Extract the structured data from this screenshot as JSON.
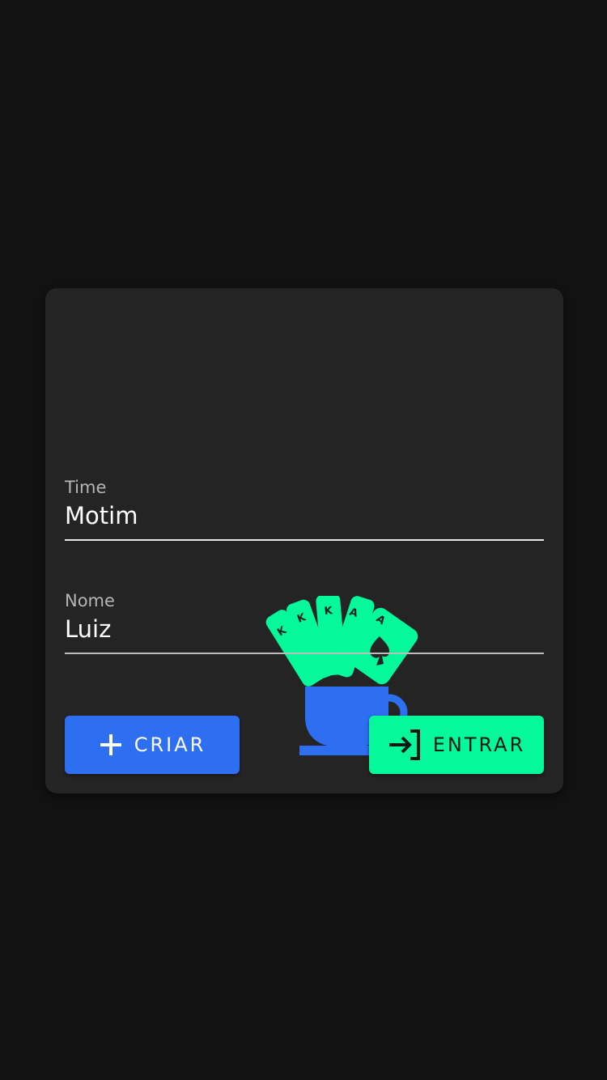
{
  "logo": {
    "name": "cards-and-coffee-cup-logo",
    "card_letters": [
      "K",
      "K",
      "K",
      "A",
      "A"
    ],
    "colors": {
      "cards": "#05f99a",
      "cup": "#2d6ff0"
    }
  },
  "form": {
    "team": {
      "label": "Time",
      "value": "Motim"
    },
    "name": {
      "label": "Nome",
      "value": "Luiz"
    }
  },
  "buttons": {
    "create": {
      "label": "CRIAR",
      "icon": "plus-icon",
      "color": "#2d6ff0"
    },
    "join": {
      "label": "ENTRAR",
      "icon": "login-icon",
      "color": "#05f99a"
    }
  }
}
